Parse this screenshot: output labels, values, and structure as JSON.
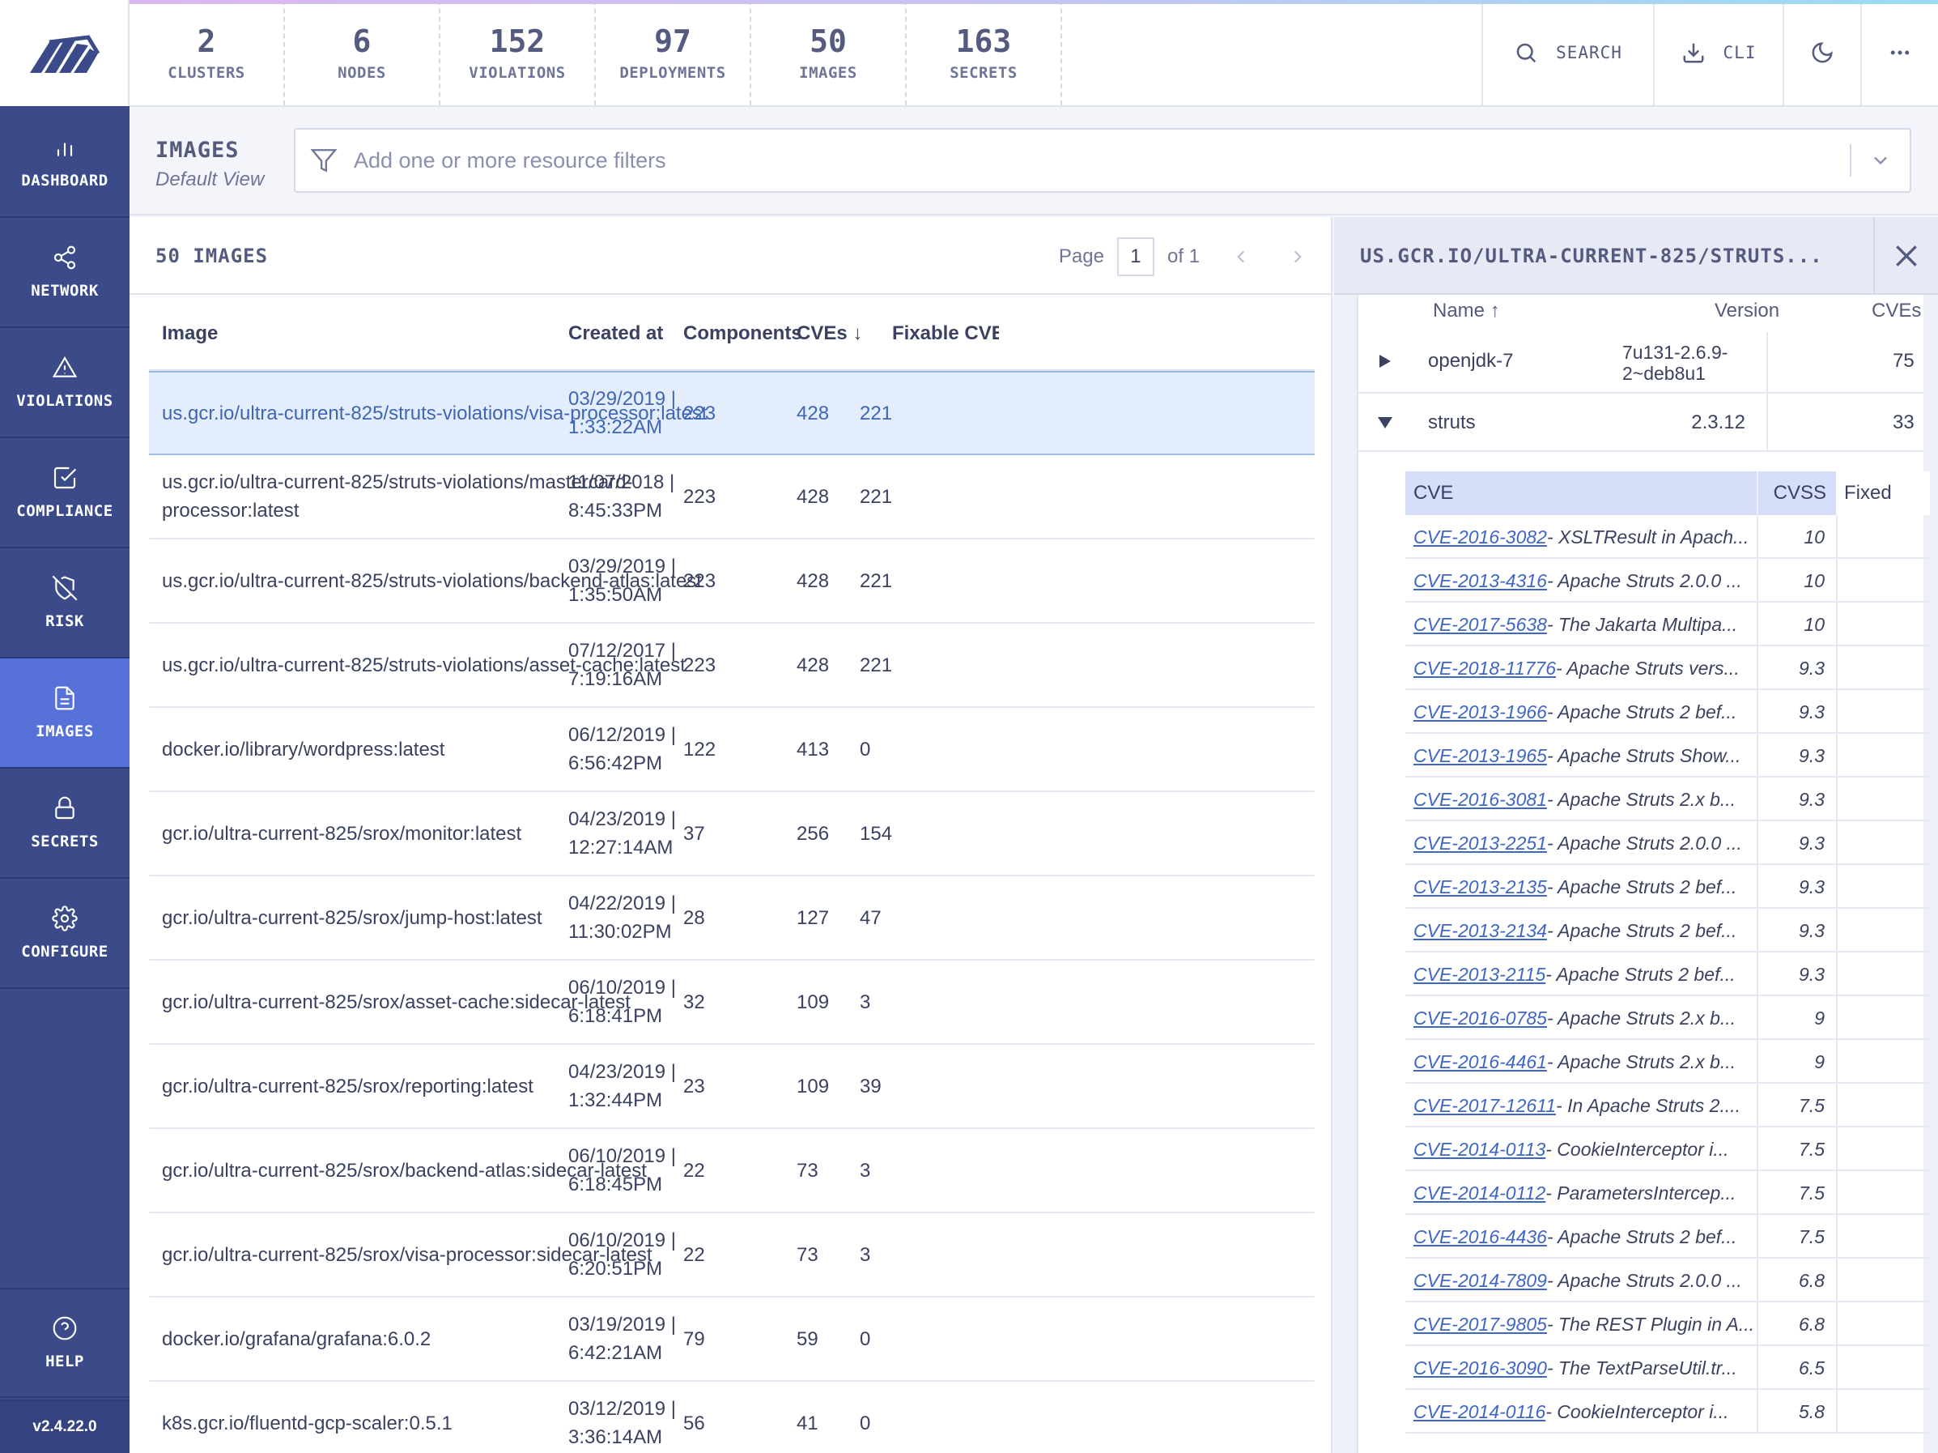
{
  "nav": {
    "items": [
      {
        "label": "DASHBOARD",
        "icon": "bar-chart-icon"
      },
      {
        "label": "NETWORK",
        "icon": "share-icon"
      },
      {
        "label": "VIOLATIONS",
        "icon": "alert-triangle-icon"
      },
      {
        "label": "COMPLIANCE",
        "icon": "check-square-icon"
      },
      {
        "label": "RISK",
        "icon": "shield-off-icon"
      },
      {
        "label": "IMAGES",
        "icon": "file-icon"
      },
      {
        "label": "SECRETS",
        "icon": "lock-icon"
      },
      {
        "label": "CONFIGURE",
        "icon": "gear-icon"
      }
    ],
    "help": "HELP",
    "version": "v2.4.22.0",
    "active_color": "#5671d8",
    "bg_color": "#3b4b8a"
  },
  "summary": [
    {
      "value": "2",
      "label": "CLUSTERS"
    },
    {
      "value": "6",
      "label": "NODES"
    },
    {
      "value": "152",
      "label": "VIOLATIONS"
    },
    {
      "value": "97",
      "label": "DEPLOYMENTS"
    },
    {
      "value": "50",
      "label": "IMAGES"
    },
    {
      "value": "163",
      "label": "SECRETS"
    }
  ],
  "topbar": {
    "search_label": "SEARCH",
    "cli_label": "CLI"
  },
  "page": {
    "title": "IMAGES",
    "subtitle": "Default View",
    "filter_placeholder": "Add one or more resource filters"
  },
  "list": {
    "count": "50 IMAGES",
    "page_label": "Page",
    "page_value": "1",
    "of_label": "of 1",
    "columns": [
      "Image",
      "Created at",
      "Components",
      "CVEs",
      "Fixable CVE"
    ],
    "rows": [
      {
        "image": "us.gcr.io/ultra-current-825/struts-violations/visa-processor:latest",
        "date": "03/29/2019 | 1:33:22AM",
        "components": "223",
        "cves": "428",
        "fixable": "221"
      },
      {
        "image": "us.gcr.io/ultra-current-825/struts-violations/mastercard-processor:latest",
        "date": "11/07/2018 | 8:45:33PM",
        "components": "223",
        "cves": "428",
        "fixable": "221"
      },
      {
        "image": "us.gcr.io/ultra-current-825/struts-violations/backend-atlas:latest",
        "date": "03/29/2019 | 1:35:50AM",
        "components": "223",
        "cves": "428",
        "fixable": "221"
      },
      {
        "image": "us.gcr.io/ultra-current-825/struts-violations/asset-cache:latest",
        "date": "07/12/2017 | 7:19:16AM",
        "components": "223",
        "cves": "428",
        "fixable": "221"
      },
      {
        "image": "docker.io/library/wordpress:latest",
        "date": "06/12/2019 | 6:56:42PM",
        "components": "122",
        "cves": "413",
        "fixable": "0"
      },
      {
        "image": "gcr.io/ultra-current-825/srox/monitor:latest",
        "date": "04/23/2019 | 12:27:14AM",
        "components": "37",
        "cves": "256",
        "fixable": "154"
      },
      {
        "image": "gcr.io/ultra-current-825/srox/jump-host:latest",
        "date": "04/22/2019 | 11:30:02PM",
        "components": "28",
        "cves": "127",
        "fixable": "47"
      },
      {
        "image": "gcr.io/ultra-current-825/srox/asset-cache:sidecar-latest",
        "date": "06/10/2019 | 6:18:41PM",
        "components": "32",
        "cves": "109",
        "fixable": "3"
      },
      {
        "image": "gcr.io/ultra-current-825/srox/reporting:latest",
        "date": "04/23/2019 | 1:32:44PM",
        "components": "23",
        "cves": "109",
        "fixable": "39"
      },
      {
        "image": "gcr.io/ultra-current-825/srox/backend-atlas:sidecar-latest",
        "date": "06/10/2019 | 6:18:45PM",
        "components": "22",
        "cves": "73",
        "fixable": "3"
      },
      {
        "image": "gcr.io/ultra-current-825/srox/visa-processor:sidecar-latest",
        "date": "06/10/2019 | 6:20:51PM",
        "components": "22",
        "cves": "73",
        "fixable": "3"
      },
      {
        "image": "docker.io/grafana/grafana:6.0.2",
        "date": "03/19/2019 | 6:42:21AM",
        "components": "79",
        "cves": "59",
        "fixable": "0"
      },
      {
        "image": "k8s.gcr.io/fluentd-gcp-scaler:0.5.1",
        "date": "03/12/2019 | 3:36:14AM",
        "components": "56",
        "cves": "41",
        "fixable": "0"
      }
    ]
  },
  "side": {
    "title": "US.GCR.IO/ULTRA-CURRENT-825/STRUTS...",
    "columns": {
      "name": "Name",
      "version": "Version",
      "cves": "CVEs"
    },
    "components": [
      {
        "name": "openjdk-7",
        "version": "7u131-2.6.9-2~deb8u1",
        "cves": "75",
        "expanded": false
      },
      {
        "name": "struts",
        "version": "2.3.12",
        "cves": "33",
        "expanded": true
      }
    ],
    "cve_columns": {
      "cve": "CVE",
      "cvss": "CVSS",
      "fixed": "Fixed"
    },
    "cves": [
      {
        "id": "CVE-2016-3082",
        "desc": "- XSLTResult in Apach...",
        "cvss": "10"
      },
      {
        "id": "CVE-2013-4316",
        "desc": "- Apache Struts 2.0.0 ...",
        "cvss": "10"
      },
      {
        "id": "CVE-2017-5638",
        "desc": "- The Jakarta Multipa...",
        "cvss": "10"
      },
      {
        "id": "CVE-2018-11776",
        "desc": "- Apache Struts vers...",
        "cvss": "9.3"
      },
      {
        "id": "CVE-2013-1966",
        "desc": "- Apache Struts 2 bef...",
        "cvss": "9.3"
      },
      {
        "id": "CVE-2013-1965",
        "desc": "- Apache Struts Show...",
        "cvss": "9.3"
      },
      {
        "id": "CVE-2016-3081",
        "desc": "- Apache Struts 2.x b...",
        "cvss": "9.3"
      },
      {
        "id": "CVE-2013-2251",
        "desc": "- Apache Struts 2.0.0 ...",
        "cvss": "9.3"
      },
      {
        "id": "CVE-2013-2135",
        "desc": "- Apache Struts 2 bef...",
        "cvss": "9.3"
      },
      {
        "id": "CVE-2013-2134",
        "desc": "- Apache Struts 2 bef...",
        "cvss": "9.3"
      },
      {
        "id": "CVE-2013-2115",
        "desc": "- Apache Struts 2 bef...",
        "cvss": "9.3"
      },
      {
        "id": "CVE-2016-0785",
        "desc": "- Apache Struts 2.x b...",
        "cvss": "9"
      },
      {
        "id": "CVE-2016-4461",
        "desc": "- Apache Struts 2.x b...",
        "cvss": "9"
      },
      {
        "id": "CVE-2017-12611",
        "desc": "- In Apache Struts 2....",
        "cvss": "7.5"
      },
      {
        "id": "CVE-2014-0113",
        "desc": "- CookieInterceptor i...",
        "cvss": "7.5"
      },
      {
        "id": "CVE-2014-0112",
        "desc": "- ParametersIntercep...",
        "cvss": "7.5"
      },
      {
        "id": "CVE-2016-4436",
        "desc": "- Apache Struts 2 bef...",
        "cvss": "7.5"
      },
      {
        "id": "CVE-2014-7809",
        "desc": "- Apache Struts 2.0.0 ...",
        "cvss": "6.8"
      },
      {
        "id": "CVE-2017-9805",
        "desc": "- The REST Plugin in A...",
        "cvss": "6.8"
      },
      {
        "id": "CVE-2016-3090",
        "desc": "- The TextParseUtil.tr...",
        "cvss": "6.5"
      },
      {
        "id": "CVE-2014-0116",
        "desc": "- CookieInterceptor i...",
        "cvss": "5.8"
      }
    ]
  }
}
